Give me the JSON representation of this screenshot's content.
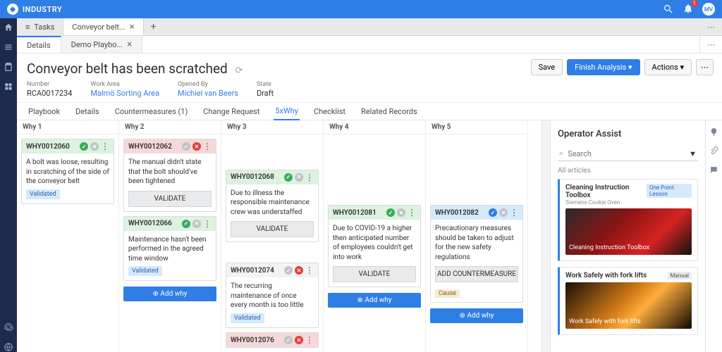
{
  "brand": "INDUSTRY",
  "notificationCount": "1",
  "avatarInitials": "MV",
  "mainTabs": {
    "tasks": "Tasks",
    "conveyor": "Conveyor belt..."
  },
  "subTabs": {
    "details": "Details",
    "demo": "Demo Playbo..."
  },
  "header": {
    "title": "Conveyor belt has been scratched",
    "meta": {
      "numberLabel": "Number",
      "number": "RCA0017234",
      "workAreaLabel": "Work Area",
      "workArea": "Malmö Sorting Area",
      "openedByLabel": "Opened By",
      "openedBy": "Michiel van Beers",
      "stateLabel": "State",
      "state": "Draft"
    },
    "actions": {
      "save": "Save",
      "finish": "Finish Analysis",
      "actions": "Actions"
    }
  },
  "nav": {
    "playbook": "Playbook",
    "details": "Details",
    "counter": "Countermeasures (1)",
    "change": "Change Request",
    "why": "5xWhy",
    "checklist": "Checklist",
    "related": "Related Records"
  },
  "cols": {
    "w1": "Why 1",
    "w2": "Why 2",
    "w3": "Why 3",
    "w4": "Why 4",
    "w5": "Why 5"
  },
  "buttons": {
    "validate": "VALIDATE",
    "addCounter": "ADD COUNTERMEASURE",
    "addWhy": "Add why"
  },
  "tags": {
    "validated": "Validated",
    "cause": "Cause"
  },
  "cards": {
    "c60": {
      "id": "WHY0012060",
      "text": "A bolt was loose, resulting in scratching of the side of the conveyor belt"
    },
    "c62": {
      "id": "WHY0012062",
      "text": "The manual didn't state that the bolt should've been tightened"
    },
    "c66": {
      "id": "WHY0012066",
      "text": "Maintenance hasn't been performed in the agreed time window"
    },
    "c68": {
      "id": "WHY0012068",
      "text": "Due to illness the responsible maintenance crew was understaffed"
    },
    "c74": {
      "id": "WHY0012074",
      "text": "The recurring maintenance of once every month is too little"
    },
    "c76": {
      "id": "WHY0012076"
    },
    "c81": {
      "id": "WHY0012081",
      "text": "Due to COVID-19 a higher then anticipated number of employees couldn't get into work"
    },
    "c82": {
      "id": "WHY0012082",
      "text": "Precautionary measures should be taken to adjust for the new safety regulations"
    }
  },
  "assist": {
    "title": "Operator Assist",
    "searchPlaceholder": "Search",
    "allArticles": "All articles",
    "a1": {
      "title": "Cleaning Instruction Toolbox",
      "sub": "Siemens Cookie Oven",
      "badge": "One Point Lesson",
      "caption": "Cleaning Instruction Toolbox"
    },
    "a2": {
      "title": "Work Safely with fork lifts",
      "badge": "Manual",
      "caption": "Work Safely with fork lifts"
    }
  }
}
